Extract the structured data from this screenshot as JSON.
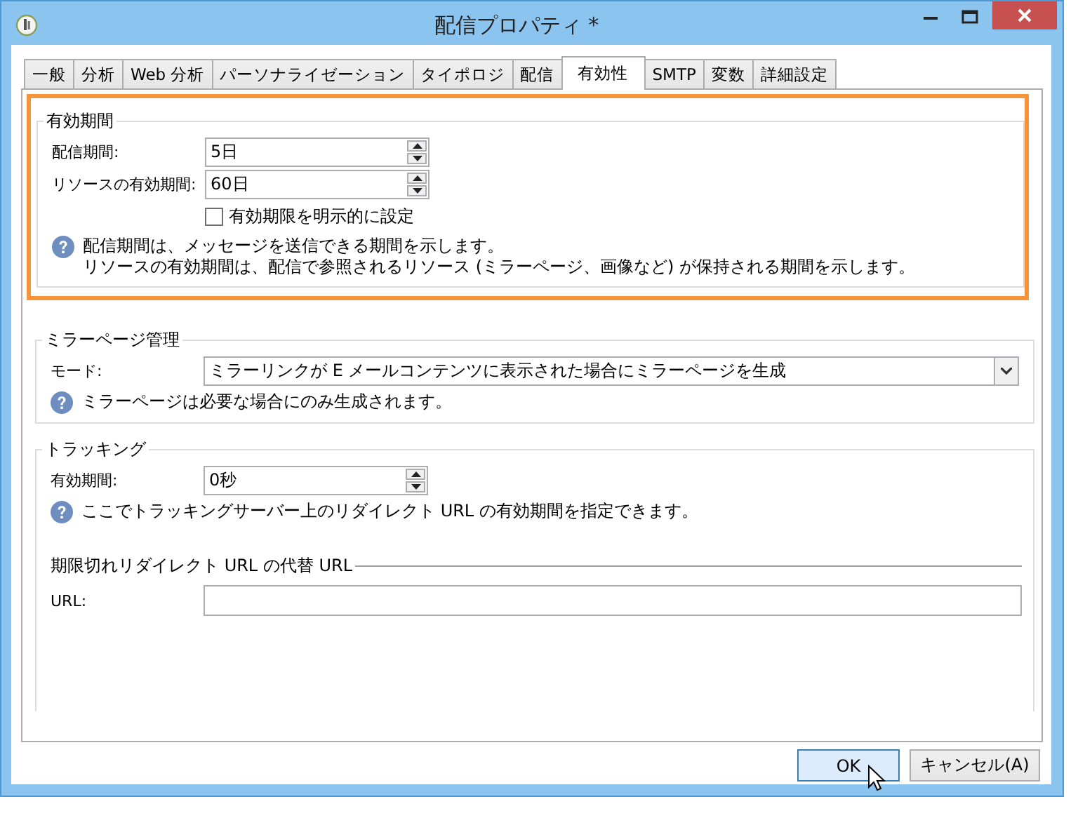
{
  "window": {
    "title": "配信プロパティ *"
  },
  "tabs": [
    {
      "label": "一般",
      "selected": false
    },
    {
      "label": "分析",
      "selected": false
    },
    {
      "label": "Web 分析",
      "selected": false
    },
    {
      "label": "パーソナライゼーション",
      "selected": false
    },
    {
      "label": "タイポロジ",
      "selected": false
    },
    {
      "label": "配信",
      "selected": false
    },
    {
      "label": "有効性",
      "selected": true
    },
    {
      "label": "SMTP",
      "selected": false
    },
    {
      "label": "変数",
      "selected": false
    },
    {
      "label": "詳細設定",
      "selected": false
    }
  ],
  "validity": {
    "title": "有効期間",
    "highlighted": true,
    "fields": [
      {
        "label": "配信期間:",
        "value": "5日"
      },
      {
        "label": "リソースの有効期間:",
        "value": "60日"
      }
    ],
    "checkbox": {
      "label": "有効期限を明示的に設定",
      "checked": false
    },
    "help": [
      "配信期間は、メッセージを送信できる期間を示します。",
      "リソースの有効期間は、配信で参照されるリソース (ミラーページ、画像など) が保持される期間を示します。"
    ]
  },
  "mirror_page": {
    "title": "ミラーページ管理",
    "mode_label": "モード:",
    "mode_value": "ミラーリンクが E メールコンテンツに表示された場合にミラーページを生成",
    "help": "ミラーページは必要な場合にのみ生成されます。"
  },
  "tracking": {
    "title": "トラッキング",
    "field": {
      "label": "有効期間:",
      "value": "0秒"
    },
    "help": "ここでトラッキングサーバー上のリダイレクト URL の有効期間を指定できます。",
    "fallback": {
      "title": "期限切れリダイレクト URL の代替 URL",
      "url_label": "URL:"
    }
  },
  "buttons": [
    {
      "label": "OK",
      "default": true
    },
    {
      "label": "キャンセル(A)",
      "default": false
    }
  ]
}
